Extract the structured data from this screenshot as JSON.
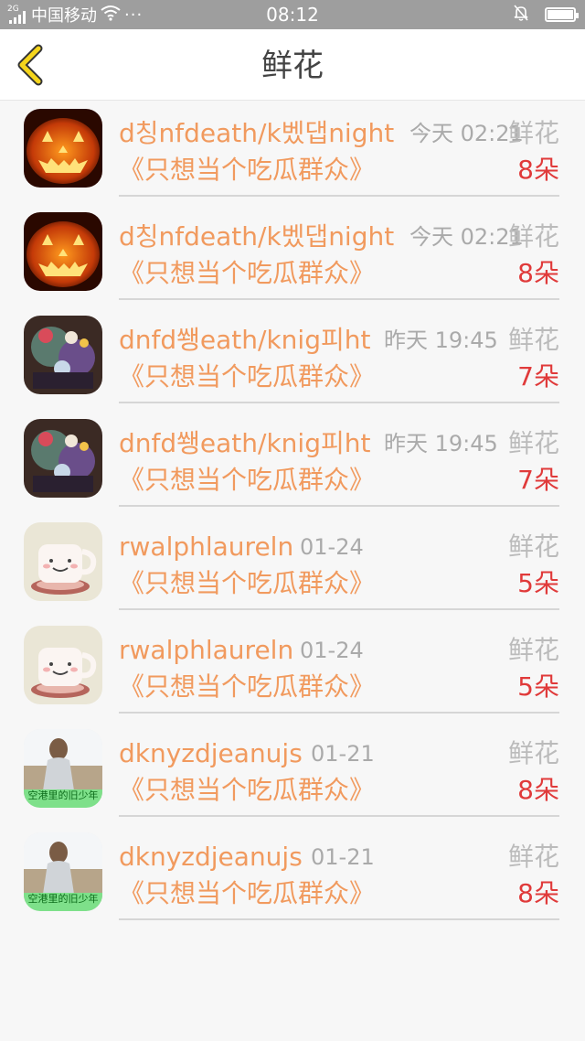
{
  "status_bar": {
    "network_tag": "2G",
    "carrier": "中国移动",
    "more": "···",
    "time": "08:12"
  },
  "header": {
    "title": "鲜花"
  },
  "items": [
    {
      "name": "d칭nfdeath/k벴댑night",
      "time": "今天 02:21",
      "type": "鲜花",
      "group": "《只想当个吃瓜群众》",
      "count": "8朵",
      "avatar": "pumpkin-avatar"
    },
    {
      "name": "d칭nfdeath/k벴댑night",
      "time": "今天 02:21",
      "type": "鲜花",
      "group": "《只想当个吃瓜群众》",
      "count": "8朵",
      "avatar": "pumpkin-avatar"
    },
    {
      "name": "dnfd쐥eath/knig피ht",
      "time": "昨天 19:45",
      "type": "鲜花",
      "group": "《只想当个吃瓜群众》",
      "count": "7朵",
      "avatar": "anime-avatar"
    },
    {
      "name": "dnfd쐥eath/knig피ht",
      "time": "昨天 19:45",
      "type": "鲜花",
      "group": "《只想当个吃瓜群众》",
      "count": "7朵",
      "avatar": "anime-avatar"
    },
    {
      "name": "rwalphlaureln",
      "time": "01-24",
      "type": "鲜花",
      "group": "《只想当个吃瓜群众》",
      "count": "5朵",
      "avatar": "cup-avatar"
    },
    {
      "name": "rwalphlaureln",
      "time": "01-24",
      "type": "鲜花",
      "group": "《只想当个吃瓜群众》",
      "count": "5朵",
      "avatar": "cup-avatar"
    },
    {
      "name": "dknyzdjeanujs",
      "time": "01-21",
      "type": "鲜花",
      "group": "《只想当个吃瓜群众》",
      "count": "8朵",
      "avatar": "girl-avatar",
      "avatar_caption": "空港里的旧少年"
    },
    {
      "name": "dknyzdjeanujs",
      "time": "01-21",
      "type": "鲜花",
      "group": "《只想当个吃瓜群众》",
      "count": "8朵",
      "avatar": "girl-avatar",
      "avatar_caption": "空港里的旧少年"
    }
  ],
  "colors": {
    "status_bar": "#9e9e9e",
    "accent_orange": "#f19a5e",
    "count_red": "#e03a3a",
    "back_yellow": "#f5d51c"
  }
}
